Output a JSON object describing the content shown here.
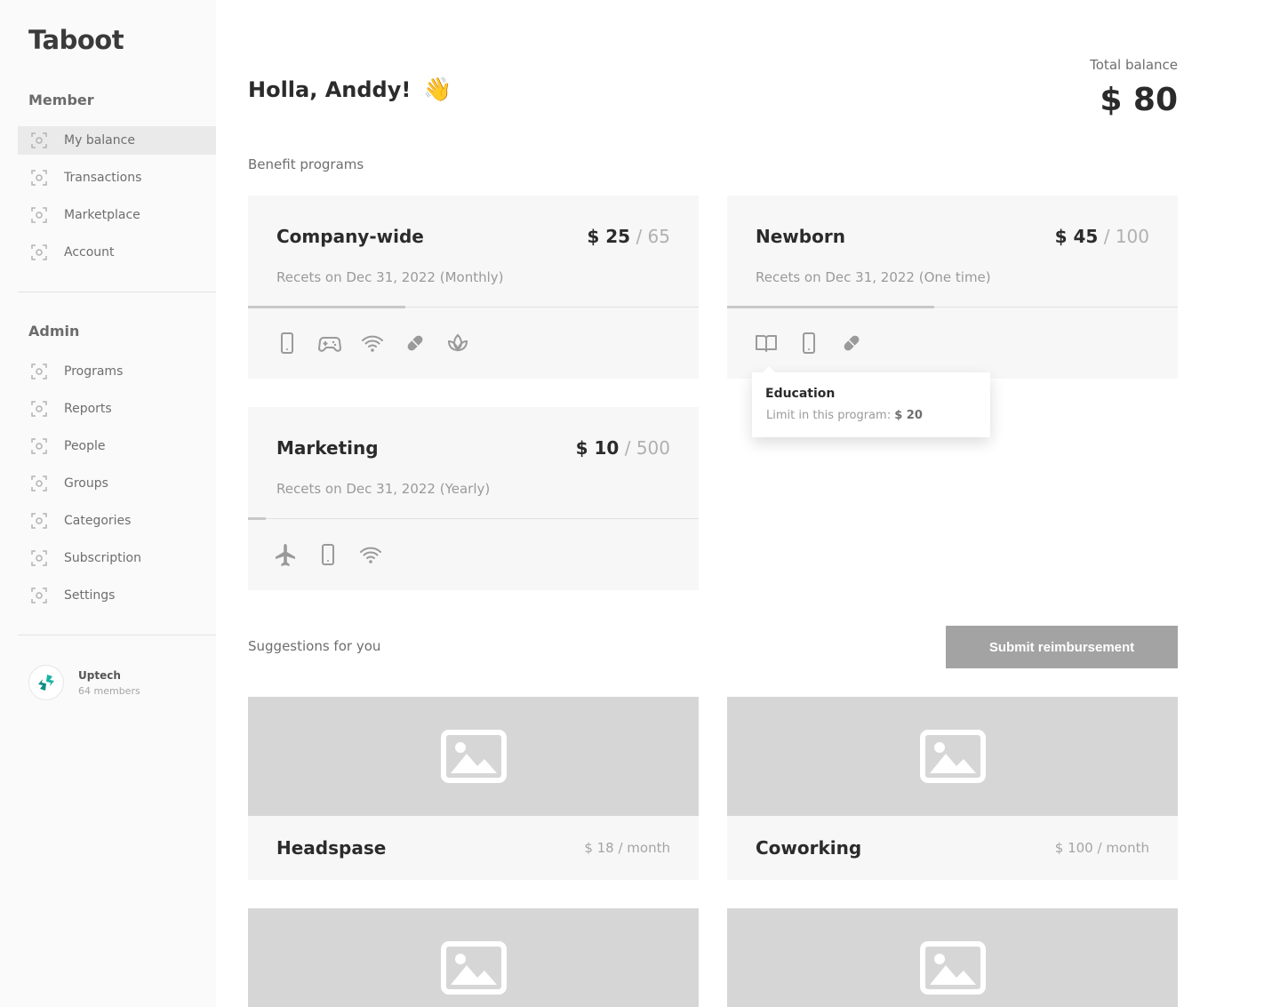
{
  "app": {
    "logo": "Taboot"
  },
  "sidebar": {
    "member_title": "Member",
    "member_items": [
      {
        "label": "My balance",
        "active": true
      },
      {
        "label": "Transactions"
      },
      {
        "label": "Marketplace"
      },
      {
        "label": "Account"
      }
    ],
    "admin_title": "Admin",
    "admin_items": [
      {
        "label": "Programs"
      },
      {
        "label": "Reports"
      },
      {
        "label": "People"
      },
      {
        "label": "Groups"
      },
      {
        "label": "Categories"
      },
      {
        "label": "Subscription"
      },
      {
        "label": "Settings"
      }
    ],
    "org": {
      "name": "Uptech",
      "members": "64 members"
    }
  },
  "header": {
    "greeting": "Holla, Anddy!",
    "wave": "👋",
    "total_label": "Total balance",
    "total_value": "$ 80"
  },
  "benefits": {
    "title": "Benefit programs",
    "programs": [
      {
        "title": "Company-wide",
        "amount": "$ 25",
        "limit": " / 65",
        "resets": "Recets on Dec 31, 2022 (Monthly)",
        "progress": 0.35,
        "icons": [
          "phone-icon",
          "gamepad-icon",
          "wifi-icon",
          "pill-icon",
          "lotus-icon"
        ]
      },
      {
        "title": "Newborn",
        "amount": "$ 45",
        "limit": " / 100",
        "resets": "Recets on Dec 31, 2022 (One time)",
        "progress": 0.46,
        "icons": [
          "book-icon",
          "phone-icon",
          "pill-icon"
        ]
      },
      {
        "title": "Marketing",
        "amount": "$ 10",
        "limit": " / 500",
        "resets": "Recets on Dec 31, 2022 (Yearly)",
        "progress": 0.04,
        "icons": [
          "airplane-icon",
          "phone-icon",
          "wifi-icon"
        ]
      }
    ],
    "tooltip": {
      "title": "Education",
      "text": "Limit in this program: ",
      "value": "$ 20"
    }
  },
  "suggestions": {
    "title": "Suggestions for you",
    "submit_label": "Submit reimbursement",
    "items": [
      {
        "name": "Headspase",
        "price": "$ 18 / month"
      },
      {
        "name": "Coworking",
        "price": "$ 100 / month"
      }
    ]
  }
}
